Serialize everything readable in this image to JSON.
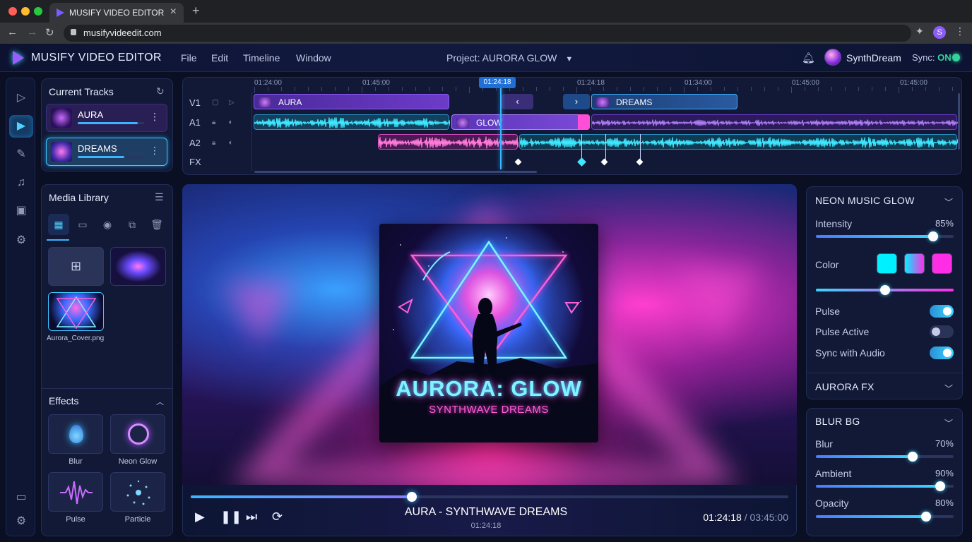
{
  "browser": {
    "tab_title": "MUSIFY VIDEO EDITOR",
    "url": "musifyvideedit.com",
    "profile_initial": "S"
  },
  "app": {
    "title": "MUSIFY VIDEO EDITOR",
    "menu": [
      "File",
      "Edit",
      "Timeline",
      "Window"
    ],
    "project": "Project: AURORA GLOW",
    "user": "SynthDream",
    "sync_label": "Sync:",
    "sync_state": "ON"
  },
  "tracks_panel": {
    "title": "Current Tracks",
    "items": [
      {
        "name": "AURA",
        "progress": 0.9
      },
      {
        "name": "DREAMS",
        "progress": 0.7
      }
    ]
  },
  "media_library": {
    "title": "Media Library",
    "file_name": "Aurora_Cover.png"
  },
  "effects": {
    "title": "Effects",
    "items": [
      "Blur",
      "Neon Glow",
      "Pulse",
      "Particle"
    ]
  },
  "timeline": {
    "ruler": [
      "01:24:00",
      "01:45:00",
      "01:24:18",
      "01:34:00",
      "01:45:00",
      "01:45:00"
    ],
    "playhead": "01:24:18",
    "rows": [
      "V1",
      "A1",
      "A2",
      "FX"
    ],
    "clips": {
      "v1_a": "AURA",
      "v1_b": "DREAMS",
      "a1": "GLOW"
    }
  },
  "preview": {
    "cover_title": "AURORA: GLOW",
    "cover_subtitle": "SYNTHWAVE DREAMS"
  },
  "transport": {
    "now_playing": "AURA - SYNTHWAVE DREAMS",
    "now_time": "01:24:18",
    "current": "01:24:18",
    "separator": "/",
    "total": "03:45:00",
    "progress": 0.37
  },
  "neon_glow": {
    "title": "NEON MUSIC GLOW",
    "intensity_label": "Intensity",
    "intensity_value": "85%",
    "intensity": 0.85,
    "color_label": "Color",
    "colors": [
      "#00f0ff",
      "#ff2ee6"
    ],
    "color_mix": 0.5,
    "pulse_label": "Pulse",
    "pulse_on": true,
    "pulse_active_label": "Pulse Active",
    "pulse_active_on": false,
    "sync_label": "Sync with Audio",
    "sync_on": true
  },
  "aurora_fx": {
    "title": "AURORA FX"
  },
  "blur_bg": {
    "title": "BLUR BG",
    "blur_label": "Blur",
    "blur_value": "70%",
    "blur": 0.7,
    "ambient_label": "Ambient",
    "ambient_value": "90%",
    "ambient": 0.9,
    "opacity_label": "Opacity",
    "opacity_value": "80%",
    "opacity": 0.8
  }
}
